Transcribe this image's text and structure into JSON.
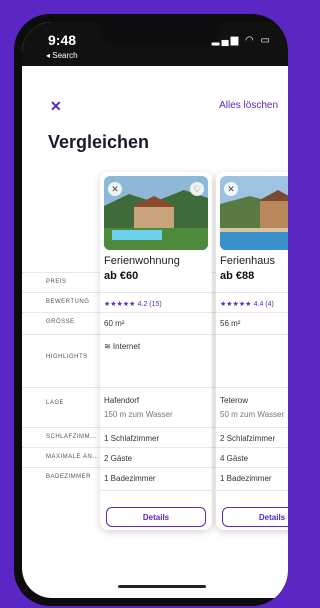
{
  "status": {
    "time": "9:48",
    "back_hint": "◂ Search",
    "icons": "▂▄▆ ◠ ▭"
  },
  "header": {
    "close_icon": "close-icon",
    "clear_all": "Alles löschen",
    "title": "Vergleichen"
  },
  "row_labels": [
    "PREIS",
    "BEWERTUNG",
    "GRÖSSE",
    "HIGHLIGHTS",
    "LAGE",
    "SCHLAFZIMM...",
    "MAXIMALE AN...",
    "BADEZIMMER"
  ],
  "cards": [
    {
      "title": "Ferienwohnung",
      "price": "ab €60",
      "rating_stars": "★★★★★",
      "rating": "4.2 (15)",
      "size": "60 m²",
      "highlight": "≋ Internet",
      "location": "Hafendorf",
      "distance": "150 m zum Wasser",
      "bedrooms": "1 Schlafzimmer",
      "guests": "2 Gäste",
      "bathrooms": "1 Badezimmer",
      "details_label": "Details"
    },
    {
      "title": "Ferienhaus",
      "price": "ab €88",
      "rating_stars": "★★★★★",
      "rating": "4.4 (4)",
      "size": "56 m²",
      "highlight": "",
      "location": "Teterow",
      "distance": "50 m zum Wasser",
      "bedrooms": "2 Schlafzimmer",
      "guests": "4 Gäste",
      "bathrooms": "1 Badezimmer",
      "details_label": "Details"
    }
  ],
  "colors": {
    "accent": "#5a27c4",
    "background": "#5a27c4"
  }
}
